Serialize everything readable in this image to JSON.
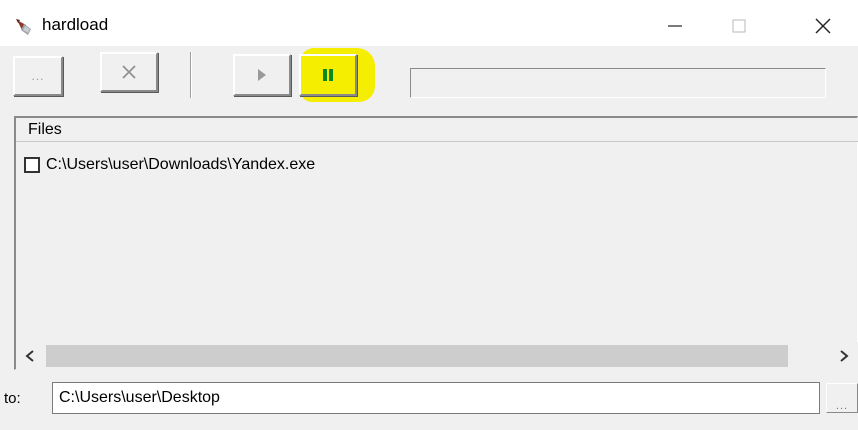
{
  "window": {
    "title": "hardload",
    "icon": "shovel-icon",
    "controls": [
      "minimize-icon",
      "maximize-icon",
      "close-icon"
    ]
  },
  "toolbar": {
    "browse_label": "...",
    "buttons": [
      "browse-button",
      "cancel-button",
      "play-button",
      "pause-button"
    ],
    "highlight_color": "#f5ee00",
    "progress_percent": 0
  },
  "files": {
    "column_header": "Files",
    "items": [
      {
        "path": "C:\\Users\\user\\Downloads\\Yandex.exe",
        "checked": false
      }
    ]
  },
  "destination": {
    "label": "to:",
    "value": "C:\\Users\\user\\Desktop",
    "browse_label": "..."
  }
}
